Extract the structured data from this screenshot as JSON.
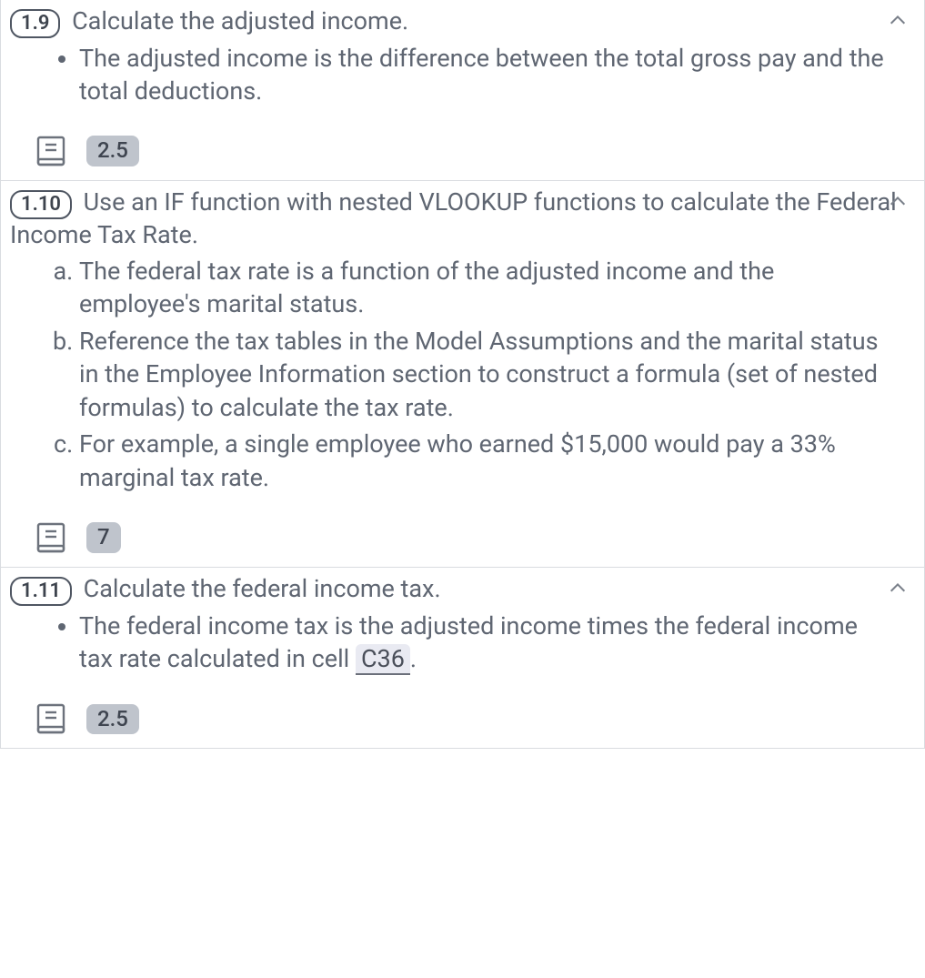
{
  "steps": [
    {
      "num": "1.9",
      "title": "Calculate the adjusted income.",
      "bullets": [
        "The adjusted income is the difference between the total gross pay and the total deductions."
      ],
      "points": "2.5"
    },
    {
      "num": "1.10",
      "title": "Use an IF function with nested VLOOKUP functions to calculate the Federal Income Tax Rate.",
      "subitems": [
        "The federal tax rate is a function of the adjusted income and the employee's marital status.",
        "Reference the tax tables in the Model Assumptions and the marital status in the Employee Information section to construct a formula (set of nested formulas) to calculate the tax rate.",
        "For example, a single employee who earned $15,000 would pay a 33% marginal tax rate."
      ],
      "points": "7"
    },
    {
      "num": "1.11",
      "title": "Calculate the federal income tax.",
      "bullet_pre": "The federal income tax is the adjusted income times the federal income tax rate calculated in cell ",
      "bullet_cell": "C36",
      "bullet_post": ".",
      "points": "2.5"
    }
  ]
}
